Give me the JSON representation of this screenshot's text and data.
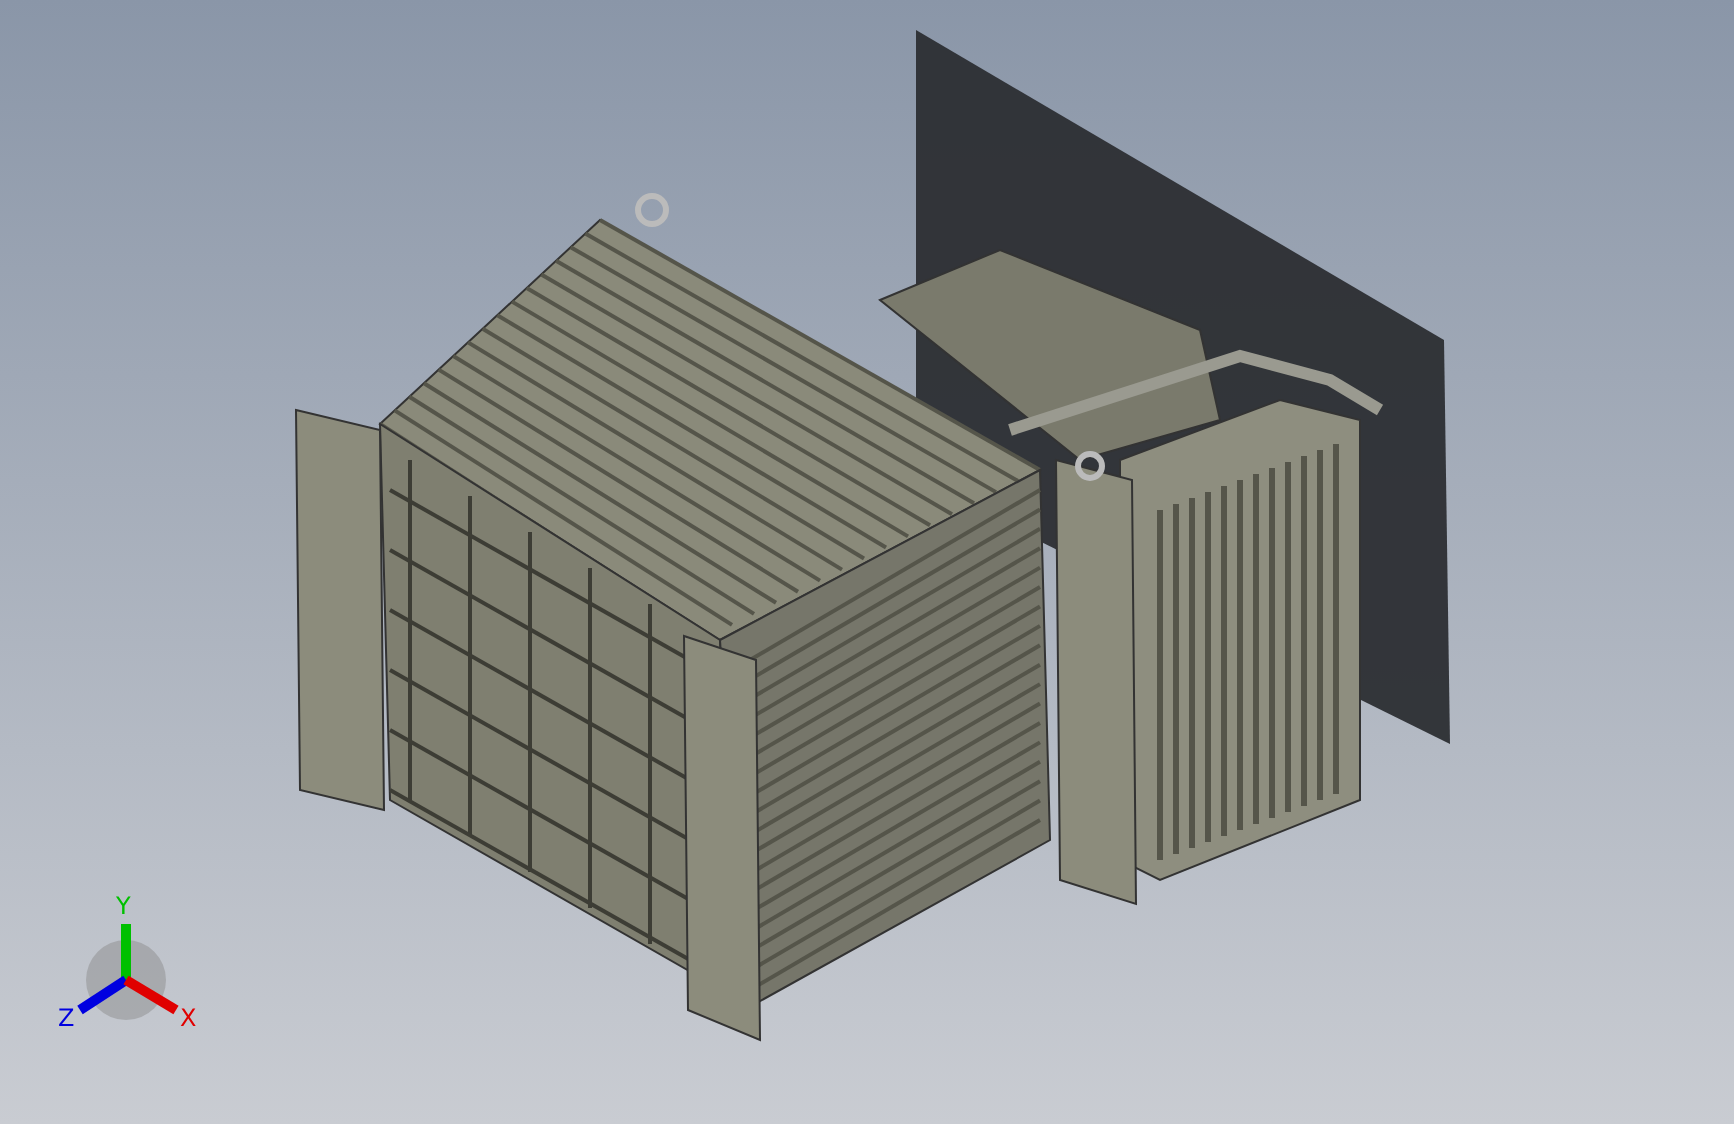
{
  "viewport": {
    "triad": {
      "axes": [
        {
          "kind": "y",
          "label": "Y",
          "color": "#00c000"
        },
        {
          "kind": "z",
          "label": "Z",
          "color": "#0000e0"
        },
        {
          "kind": "x",
          "label": "X",
          "color": "#e00000"
        }
      ]
    }
  }
}
